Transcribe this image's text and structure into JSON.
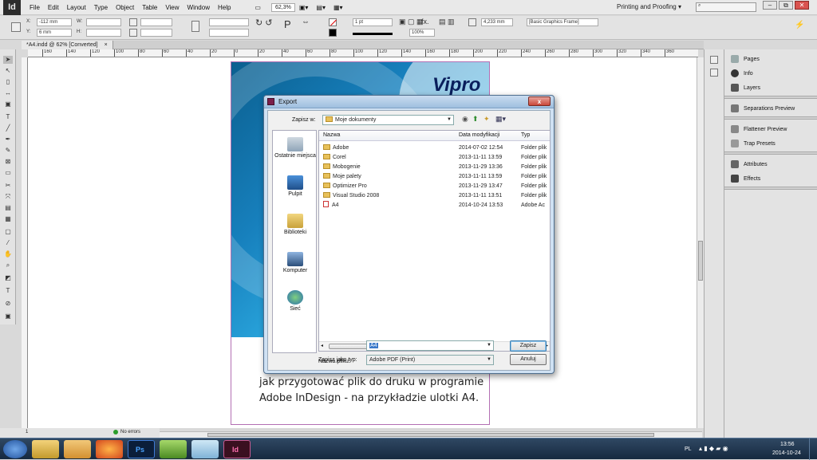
{
  "app": {
    "logo": "Id",
    "menu": [
      "File",
      "Edit",
      "Layout",
      "Type",
      "Object",
      "Table",
      "View",
      "Window",
      "Help"
    ],
    "zoom": "62,3%",
    "workspace": "Printing and Proofing",
    "window_controls": [
      "–",
      "⧉",
      "✕"
    ]
  },
  "control_bar": {
    "x_label": "X:",
    "x_value": "-112 mm",
    "y_label": "Y:",
    "y_value": "6 mm",
    "w_label": "W:",
    "h_label": "H:",
    "stroke_weight": "1 pt",
    "opacity": "100%",
    "gap_value": "4,233 mm",
    "object_style": "[Basic Graphics Frame]"
  },
  "document_tab": {
    "label": "*A4.indd @ 62% [Converted]",
    "close": "×"
  },
  "ruler": {
    "ticks": [
      "160",
      "140",
      "120",
      "100",
      "80",
      "60",
      "40",
      "20",
      "0",
      "20",
      "40",
      "60",
      "80",
      "100",
      "120",
      "140",
      "160",
      "180",
      "200",
      "220",
      "240",
      "260",
      "280",
      "300",
      "320",
      "340",
      "360"
    ]
  },
  "document": {
    "brand_text": "Vipro",
    "line1": "jak przygotować plik do druku w programie",
    "line2": "Adobe InDesign - na przykładzie ulotki A4."
  },
  "right_panel": {
    "items": [
      {
        "label": "Pages",
        "icon": "pages-icon"
      },
      {
        "label": "Info",
        "icon": "info-icon"
      },
      {
        "label": "Layers",
        "icon": "layers-icon"
      },
      {
        "label": "Separations Preview",
        "icon": "separations-icon"
      },
      {
        "label": "Flattener Preview",
        "icon": "flattener-icon"
      },
      {
        "label": "Trap Presets",
        "icon": "trap-icon"
      },
      {
        "label": "Attributes",
        "icon": "attributes-icon"
      },
      {
        "label": "Effects",
        "icon": "effects-icon"
      }
    ]
  },
  "status_bar": {
    "page": "1",
    "preflight": "No errors"
  },
  "export_dialog": {
    "title": "Export",
    "close": "x",
    "save_in_label": "Zapisz w:",
    "save_in_value": "Moje dokumenty",
    "places": [
      {
        "label": "Ostatnie miejsca",
        "icon": "recent-places-icon"
      },
      {
        "label": "Pulpit",
        "icon": "desktop-icon"
      },
      {
        "label": "Biblioteki",
        "icon": "libraries-icon"
      },
      {
        "label": "Komputer",
        "icon": "computer-icon"
      },
      {
        "label": "Sieć",
        "icon": "network-icon"
      }
    ],
    "columns": [
      "Nazwa",
      "Data modyfikacji",
      "Typ"
    ],
    "files": [
      {
        "name": "Adobe",
        "date": "2014-07-02 12:54",
        "type": "Folder plik",
        "kind": "folder"
      },
      {
        "name": "Corel",
        "date": "2013-11-11 13:59",
        "type": "Folder plik",
        "kind": "folder"
      },
      {
        "name": "Mobogenie",
        "date": "2013-11-29 13:36",
        "type": "Folder plik",
        "kind": "folder"
      },
      {
        "name": "Moje palety",
        "date": "2013-11-11 13:59",
        "type": "Folder plik",
        "kind": "folder"
      },
      {
        "name": "Optimizer Pro",
        "date": "2013-11-29 13:47",
        "type": "Folder plik",
        "kind": "folder"
      },
      {
        "name": "Visual Studio 2008",
        "date": "2013-11-11 13:51",
        "type": "Folder plik",
        "kind": "folder"
      },
      {
        "name": "A4",
        "date": "2014-10-24 13:53",
        "type": "Adobe Ac",
        "kind": "pdf"
      }
    ],
    "filename_label": "Nazwa pliku:",
    "filename_value": "A4",
    "filetype_label": "Zapisz jako typ:",
    "filetype_value": "Adobe PDF (Print)",
    "save_button": "Zapisz",
    "cancel_button": "Anuluj"
  },
  "taskbar": {
    "apps": [
      "start",
      "explorer",
      "folder",
      "firefox",
      "photoshop",
      "green-app",
      "notepad",
      "indesign"
    ],
    "lang": "PL",
    "time": "13:56",
    "date": "2014-10-24"
  },
  "colors": {
    "accent_indesign": "#7b1f4a",
    "dialog_frame": "#cfe1f3",
    "artwork_blue": "#1780bd"
  }
}
